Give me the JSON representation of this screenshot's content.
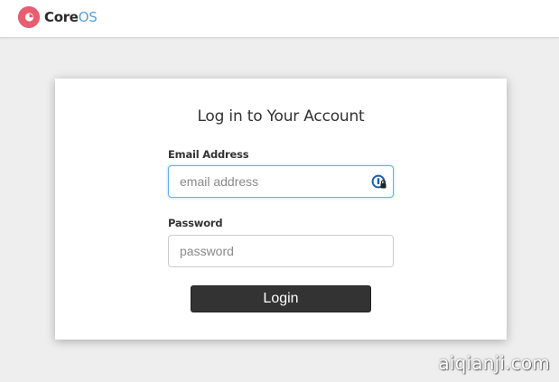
{
  "header": {
    "logo_core": "Core",
    "logo_os": "OS",
    "logo_icon": "coreos-logo-icon"
  },
  "login_card": {
    "title": "Log in to Your Account",
    "email": {
      "label": "Email Address",
      "placeholder": "email address",
      "value": "",
      "icon": "password-manager-icon"
    },
    "password": {
      "label": "Password",
      "placeholder": "password",
      "value": ""
    },
    "submit_label": "Login"
  },
  "watermark": "aiqianji.com",
  "colors": {
    "page_background": "#eeeeee",
    "brand_red": "#e85d6f",
    "brand_blue": "#53a3da",
    "button": "#333333",
    "focus_border": "#66afe9"
  }
}
